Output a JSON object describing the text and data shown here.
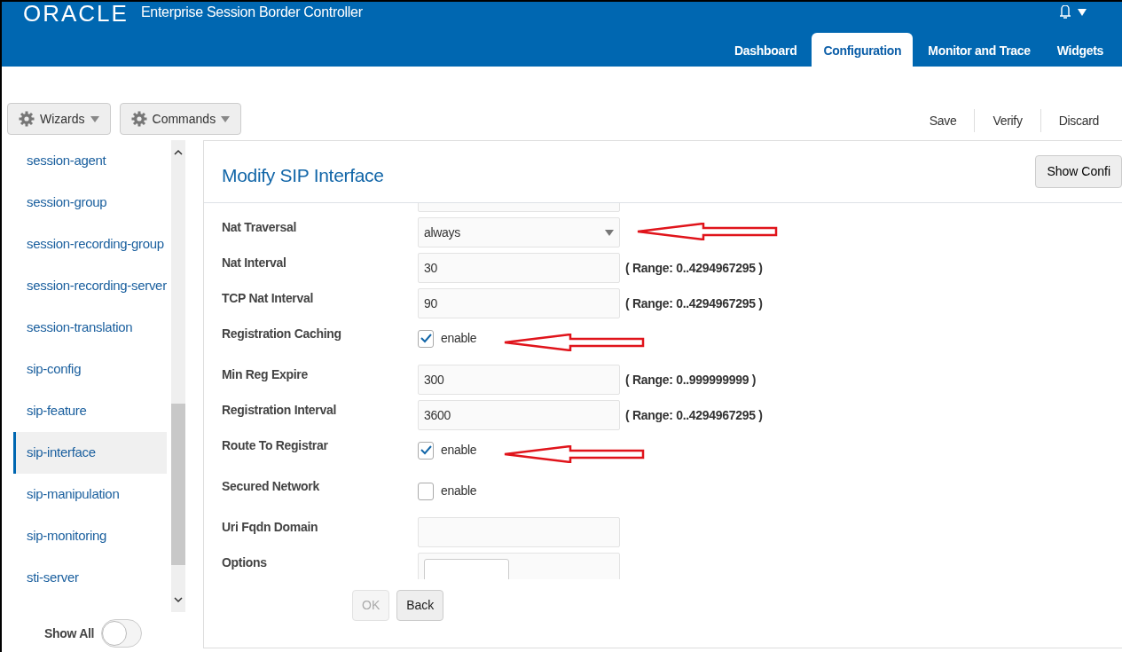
{
  "header": {
    "logo": "ORACLE",
    "product": "Enterprise Session Border Controller"
  },
  "nav_tabs": [
    {
      "label": "Dashboard",
      "selected": false
    },
    {
      "label": "Configuration",
      "selected": true
    },
    {
      "label": "Monitor and Trace",
      "selected": false
    },
    {
      "label": "Widgets",
      "selected": false
    }
  ],
  "toolbar": {
    "menus": [
      "Wizards",
      "Commands"
    ],
    "actions": [
      "Save",
      "Verify",
      "Discard"
    ]
  },
  "sidebar": {
    "items": [
      {
        "label": "session-agent",
        "selected": false
      },
      {
        "label": "session-group",
        "selected": false
      },
      {
        "label": "session-recording-group",
        "selected": false
      },
      {
        "label": "session-recording-server",
        "selected": false
      },
      {
        "label": "session-translation",
        "selected": false
      },
      {
        "label": "sip-config",
        "selected": false
      },
      {
        "label": "sip-feature",
        "selected": false
      },
      {
        "label": "sip-interface",
        "selected": true
      },
      {
        "label": "sip-manipulation",
        "selected": false
      },
      {
        "label": "sip-monitoring",
        "selected": false
      },
      {
        "label": "sti-server",
        "selected": false
      }
    ],
    "show_all": {
      "label": "Show All",
      "on": false
    }
  },
  "panel": {
    "title": "Modify SIP Interface",
    "show_config_button": "Show Confi",
    "fields": [
      {
        "kind": "text",
        "arrow": false
      },
      {
        "kind": "select",
        "label": "Nat Traversal",
        "value": "always",
        "arrow": true
      },
      {
        "kind": "text",
        "label": "Nat Interval",
        "value": "30",
        "range": "( Range: 0..4294967295 )",
        "arrow": false
      },
      {
        "kind": "text",
        "label": "TCP Nat Interval",
        "value": "90",
        "range": "( Range: 0..4294967295 )",
        "arrow": false
      },
      {
        "kind": "checkbox",
        "label": "Registration Caching",
        "checked": true,
        "option": "enable",
        "arrow": true
      },
      {
        "kind": "text",
        "label": "Min Reg Expire",
        "value": "300",
        "range": "( Range: 0..999999999 )",
        "arrow": false
      },
      {
        "kind": "text",
        "label": "Registration Interval",
        "value": "3600",
        "range": "( Range: 0..4294967295 )",
        "arrow": false
      },
      {
        "kind": "checkbox",
        "label": "Route To Registrar",
        "checked": true,
        "option": "enable",
        "arrow": true
      },
      {
        "kind": "checkbox",
        "label": "Secured Network",
        "checked": false,
        "option": "enable",
        "arrow": false
      },
      {
        "kind": "text",
        "label": "Uri Fqdn Domain",
        "arrow": false
      },
      {
        "kind": "list",
        "label": "Options",
        "arrow": false
      }
    ],
    "buttons": [
      {
        "label": "OK",
        "disabled": true
      },
      {
        "label": "Back",
        "disabled": false
      }
    ]
  }
}
